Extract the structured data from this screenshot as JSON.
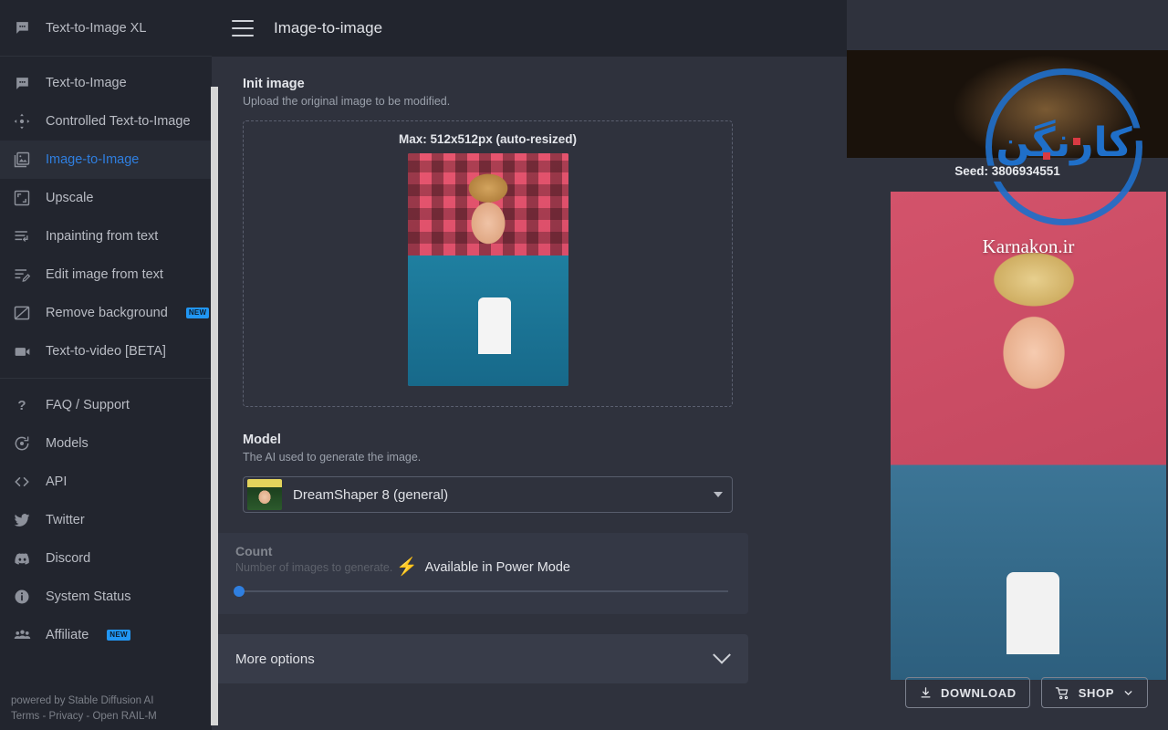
{
  "sidebar": {
    "header": {
      "label": "Text-to-Image XL",
      "icon": "chat-bubble-icon"
    },
    "items": [
      {
        "label": "Text-to-Image",
        "icon": "chat-bubble-icon",
        "active": false,
        "badge": null
      },
      {
        "label": "Controlled Text-to-Image",
        "icon": "control-move-icon",
        "active": false,
        "badge": null
      },
      {
        "label": "Image-to-Image",
        "icon": "image-icon",
        "active": true,
        "badge": null
      },
      {
        "label": "Upscale",
        "icon": "expand-icon",
        "active": false,
        "badge": null
      },
      {
        "label": "Inpainting from text",
        "icon": "inpaint-icon",
        "active": false,
        "badge": null
      },
      {
        "label": "Edit image from text",
        "icon": "edit-lines-icon",
        "active": false,
        "badge": null
      },
      {
        "label": "Remove background",
        "icon": "remove-bg-icon",
        "active": false,
        "badge": "NEW"
      },
      {
        "label": "Text-to-video [BETA]",
        "icon": "video-camera-icon",
        "active": false,
        "badge": null
      }
    ],
    "secondary_items": [
      {
        "label": "FAQ / Support",
        "icon": "question-mark-icon",
        "badge": null
      },
      {
        "label": "Models",
        "icon": "models-icon",
        "badge": null
      },
      {
        "label": "API",
        "icon": "code-brackets-icon",
        "badge": null
      },
      {
        "label": "Twitter",
        "icon": "twitter-bird-icon",
        "badge": null
      },
      {
        "label": "Discord",
        "icon": "discord-icon",
        "badge": null
      },
      {
        "label": "System Status",
        "icon": "info-circle-icon",
        "badge": null
      },
      {
        "label": "Affiliate",
        "icon": "people-group-icon",
        "badge": "NEW"
      }
    ],
    "footer": {
      "powered_by": "powered by Stable Diffusion AI",
      "links": "Terms - Privacy - Open RAIL-M"
    }
  },
  "topbar": {
    "menu_icon": "hamburger-icon",
    "title": "Image-to-image"
  },
  "form": {
    "init_image": {
      "title": "Init image",
      "subtitle": "Upload the original image to be modified.",
      "dropzone_label": "Max: 512x512px (auto-resized)"
    },
    "model": {
      "title": "Model",
      "subtitle": "The AI used to generate the image.",
      "selected": "DreamShaper 8 (general)",
      "caret_icon": "chevron-down-icon"
    },
    "count": {
      "title": "Count",
      "subtitle": "Number of images to generate.",
      "locked_label": "Available in Power Mode",
      "bolt_icon": "lightning-bolt-icon",
      "bolt_color": "#1fd38a",
      "slider_value": 1
    },
    "more_options": {
      "label": "More options",
      "chevron_icon": "chevron-down-icon"
    }
  },
  "preview": {
    "seed_label": "Seed: 3806934551",
    "overlay_text": "Karnakon.ir",
    "buttons": [
      {
        "label": "DOWNLOAD",
        "icon": "download-icon",
        "has_caret": false
      },
      {
        "label": "SHOP",
        "icon": "shopping-cart-icon",
        "has_caret": true
      }
    ]
  },
  "watermark": {
    "text": "کارنگن",
    "ring_color": "#1f6fc9",
    "accent_color": "#d93a42"
  },
  "theme": {
    "sidebar_bg": "#22252e",
    "main_bg": "#2f323d",
    "panel_bg": "#383c49",
    "accent_blue": "#2f7fe0",
    "text_primary": "#dfe1e6",
    "text_muted": "#9aa0ab"
  }
}
